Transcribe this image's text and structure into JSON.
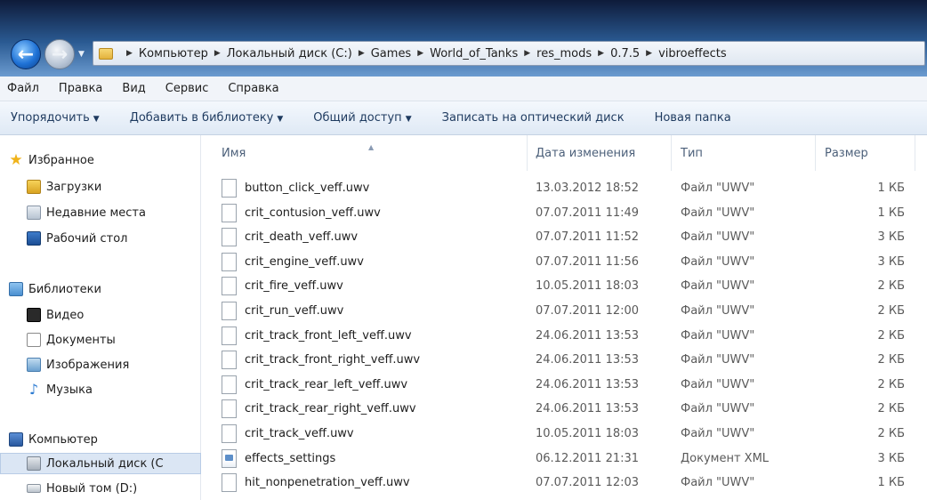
{
  "window": {
    "breadcrumb": [
      "Компьютер",
      "Локальный диск (C:)",
      "Games",
      "World_of_Tanks",
      "res_mods",
      "0.7.5",
      "vibroeffects"
    ]
  },
  "menu": [
    "Файл",
    "Правка",
    "Вид",
    "Сервис",
    "Справка"
  ],
  "toolbar": {
    "organize": "Упорядочить",
    "add_library": "Добавить в библиотеку",
    "share": "Общий доступ",
    "burn": "Записать на оптический диск",
    "new_folder": "Новая папка"
  },
  "sidebar": {
    "favorites": "Избранное",
    "downloads": "Загрузки",
    "recent": "Недавние места",
    "desktop": "Рабочий стол",
    "libraries": "Библиотеки",
    "video": "Видео",
    "documents": "Документы",
    "pictures": "Изображения",
    "music": "Музыка",
    "computer": "Компьютер",
    "local_disk": "Локальный диск (C",
    "new_volume": "Новый том (D:)"
  },
  "columns": {
    "name": "Имя",
    "date": "Дата изменения",
    "type": "Тип",
    "size": "Размер"
  },
  "files": [
    {
      "name": "button_click_veff.uwv",
      "date": "13.03.2012 18:52",
      "type": "Файл \"UWV\"",
      "size": "1 КБ"
    },
    {
      "name": "crit_contusion_veff.uwv",
      "date": "07.07.2011 11:49",
      "type": "Файл \"UWV\"",
      "size": "1 КБ"
    },
    {
      "name": "crit_death_veff.uwv",
      "date": "07.07.2011 11:52",
      "type": "Файл \"UWV\"",
      "size": "3 КБ"
    },
    {
      "name": "crit_engine_veff.uwv",
      "date": "07.07.2011 11:56",
      "type": "Файл \"UWV\"",
      "size": "3 КБ"
    },
    {
      "name": "crit_fire_veff.uwv",
      "date": "10.05.2011 18:03",
      "type": "Файл \"UWV\"",
      "size": "2 КБ"
    },
    {
      "name": "crit_run_veff.uwv",
      "date": "07.07.2011 12:00",
      "type": "Файл \"UWV\"",
      "size": "2 КБ"
    },
    {
      "name": "crit_track_front_left_veff.uwv",
      "date": "24.06.2011 13:53",
      "type": "Файл \"UWV\"",
      "size": "2 КБ"
    },
    {
      "name": "crit_track_front_right_veff.uwv",
      "date": "24.06.2011 13:53",
      "type": "Файл \"UWV\"",
      "size": "2 КБ"
    },
    {
      "name": "crit_track_rear_left_veff.uwv",
      "date": "24.06.2011 13:53",
      "type": "Файл \"UWV\"",
      "size": "2 КБ"
    },
    {
      "name": "crit_track_rear_right_veff.uwv",
      "date": "24.06.2011 13:53",
      "type": "Файл \"UWV\"",
      "size": "2 КБ"
    },
    {
      "name": "crit_track_veff.uwv",
      "date": "10.05.2011 18:03",
      "type": "Файл \"UWV\"",
      "size": "2 КБ"
    },
    {
      "name": "effects_settings",
      "date": "06.12.2011 21:31",
      "type": "Документ XML",
      "size": "3 КБ",
      "icon": "xml-file-icon"
    },
    {
      "name": "hit_nonpenetration_veff.uwv",
      "date": "07.07.2011 12:03",
      "type": "Файл \"UWV\"",
      "size": "1 КБ"
    }
  ]
}
